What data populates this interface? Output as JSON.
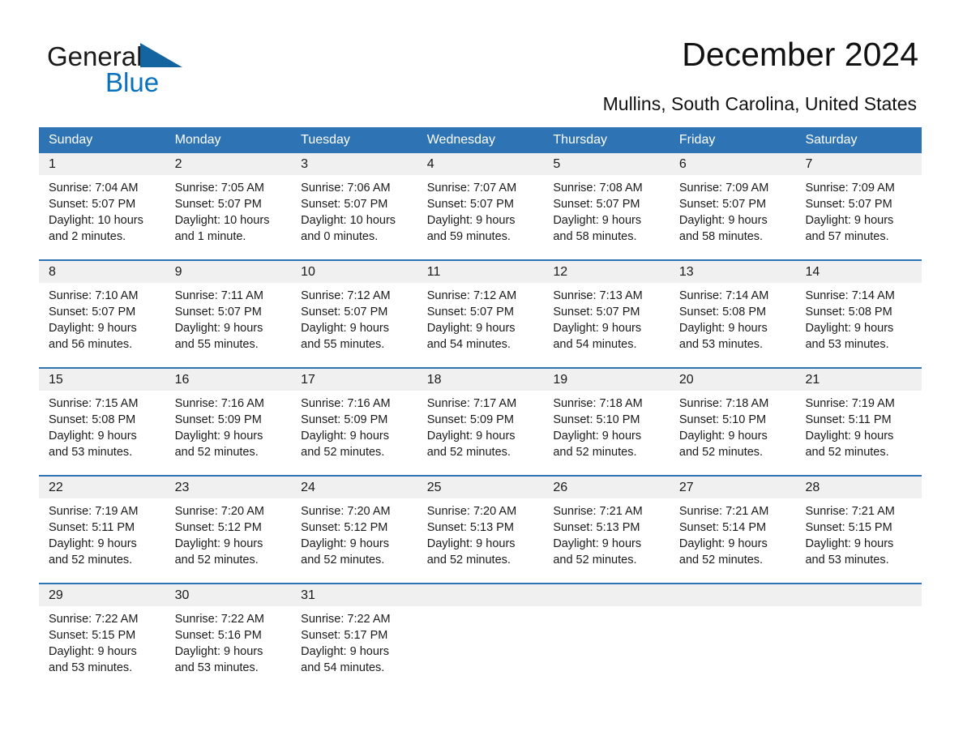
{
  "brand": {
    "word1": "General",
    "word2": "Blue",
    "accent_color": "#0a72bd",
    "triangle_icon": "triangle-logo-icon"
  },
  "header": {
    "title": "December 2024",
    "location": "Mullins, South Carolina, United States"
  },
  "calendar": {
    "header_color": "#2e74b5",
    "daynum_band_color": "#f0f0f0",
    "weekdays": [
      "Sunday",
      "Monday",
      "Tuesday",
      "Wednesday",
      "Thursday",
      "Friday",
      "Saturday"
    ],
    "weeks": [
      [
        {
          "day": "1",
          "sunrise": "Sunrise: 7:04 AM",
          "sunset": "Sunset: 5:07 PM",
          "daylight1": "Daylight: 10 hours",
          "daylight2": "and 2 minutes."
        },
        {
          "day": "2",
          "sunrise": "Sunrise: 7:05 AM",
          "sunset": "Sunset: 5:07 PM",
          "daylight1": "Daylight: 10 hours",
          "daylight2": "and 1 minute."
        },
        {
          "day": "3",
          "sunrise": "Sunrise: 7:06 AM",
          "sunset": "Sunset: 5:07 PM",
          "daylight1": "Daylight: 10 hours",
          "daylight2": "and 0 minutes."
        },
        {
          "day": "4",
          "sunrise": "Sunrise: 7:07 AM",
          "sunset": "Sunset: 5:07 PM",
          "daylight1": "Daylight: 9 hours",
          "daylight2": "and 59 minutes."
        },
        {
          "day": "5",
          "sunrise": "Sunrise: 7:08 AM",
          "sunset": "Sunset: 5:07 PM",
          "daylight1": "Daylight: 9 hours",
          "daylight2": "and 58 minutes."
        },
        {
          "day": "6",
          "sunrise": "Sunrise: 7:09 AM",
          "sunset": "Sunset: 5:07 PM",
          "daylight1": "Daylight: 9 hours",
          "daylight2": "and 58 minutes."
        },
        {
          "day": "7",
          "sunrise": "Sunrise: 7:09 AM",
          "sunset": "Sunset: 5:07 PM",
          "daylight1": "Daylight: 9 hours",
          "daylight2": "and 57 minutes."
        }
      ],
      [
        {
          "day": "8",
          "sunrise": "Sunrise: 7:10 AM",
          "sunset": "Sunset: 5:07 PM",
          "daylight1": "Daylight: 9 hours",
          "daylight2": "and 56 minutes."
        },
        {
          "day": "9",
          "sunrise": "Sunrise: 7:11 AM",
          "sunset": "Sunset: 5:07 PM",
          "daylight1": "Daylight: 9 hours",
          "daylight2": "and 55 minutes."
        },
        {
          "day": "10",
          "sunrise": "Sunrise: 7:12 AM",
          "sunset": "Sunset: 5:07 PM",
          "daylight1": "Daylight: 9 hours",
          "daylight2": "and 55 minutes."
        },
        {
          "day": "11",
          "sunrise": "Sunrise: 7:12 AM",
          "sunset": "Sunset: 5:07 PM",
          "daylight1": "Daylight: 9 hours",
          "daylight2": "and 54 minutes."
        },
        {
          "day": "12",
          "sunrise": "Sunrise: 7:13 AM",
          "sunset": "Sunset: 5:07 PM",
          "daylight1": "Daylight: 9 hours",
          "daylight2": "and 54 minutes."
        },
        {
          "day": "13",
          "sunrise": "Sunrise: 7:14 AM",
          "sunset": "Sunset: 5:08 PM",
          "daylight1": "Daylight: 9 hours",
          "daylight2": "and 53 minutes."
        },
        {
          "day": "14",
          "sunrise": "Sunrise: 7:14 AM",
          "sunset": "Sunset: 5:08 PM",
          "daylight1": "Daylight: 9 hours",
          "daylight2": "and 53 minutes."
        }
      ],
      [
        {
          "day": "15",
          "sunrise": "Sunrise: 7:15 AM",
          "sunset": "Sunset: 5:08 PM",
          "daylight1": "Daylight: 9 hours",
          "daylight2": "and 53 minutes."
        },
        {
          "day": "16",
          "sunrise": "Sunrise: 7:16 AM",
          "sunset": "Sunset: 5:09 PM",
          "daylight1": "Daylight: 9 hours",
          "daylight2": "and 52 minutes."
        },
        {
          "day": "17",
          "sunrise": "Sunrise: 7:16 AM",
          "sunset": "Sunset: 5:09 PM",
          "daylight1": "Daylight: 9 hours",
          "daylight2": "and 52 minutes."
        },
        {
          "day": "18",
          "sunrise": "Sunrise: 7:17 AM",
          "sunset": "Sunset: 5:09 PM",
          "daylight1": "Daylight: 9 hours",
          "daylight2": "and 52 minutes."
        },
        {
          "day": "19",
          "sunrise": "Sunrise: 7:18 AM",
          "sunset": "Sunset: 5:10 PM",
          "daylight1": "Daylight: 9 hours",
          "daylight2": "and 52 minutes."
        },
        {
          "day": "20",
          "sunrise": "Sunrise: 7:18 AM",
          "sunset": "Sunset: 5:10 PM",
          "daylight1": "Daylight: 9 hours",
          "daylight2": "and 52 minutes."
        },
        {
          "day": "21",
          "sunrise": "Sunrise: 7:19 AM",
          "sunset": "Sunset: 5:11 PM",
          "daylight1": "Daylight: 9 hours",
          "daylight2": "and 52 minutes."
        }
      ],
      [
        {
          "day": "22",
          "sunrise": "Sunrise: 7:19 AM",
          "sunset": "Sunset: 5:11 PM",
          "daylight1": "Daylight: 9 hours",
          "daylight2": "and 52 minutes."
        },
        {
          "day": "23",
          "sunrise": "Sunrise: 7:20 AM",
          "sunset": "Sunset: 5:12 PM",
          "daylight1": "Daylight: 9 hours",
          "daylight2": "and 52 minutes."
        },
        {
          "day": "24",
          "sunrise": "Sunrise: 7:20 AM",
          "sunset": "Sunset: 5:12 PM",
          "daylight1": "Daylight: 9 hours",
          "daylight2": "and 52 minutes."
        },
        {
          "day": "25",
          "sunrise": "Sunrise: 7:20 AM",
          "sunset": "Sunset: 5:13 PM",
          "daylight1": "Daylight: 9 hours",
          "daylight2": "and 52 minutes."
        },
        {
          "day": "26",
          "sunrise": "Sunrise: 7:21 AM",
          "sunset": "Sunset: 5:13 PM",
          "daylight1": "Daylight: 9 hours",
          "daylight2": "and 52 minutes."
        },
        {
          "day": "27",
          "sunrise": "Sunrise: 7:21 AM",
          "sunset": "Sunset: 5:14 PM",
          "daylight1": "Daylight: 9 hours",
          "daylight2": "and 52 minutes."
        },
        {
          "day": "28",
          "sunrise": "Sunrise: 7:21 AM",
          "sunset": "Sunset: 5:15 PM",
          "daylight1": "Daylight: 9 hours",
          "daylight2": "and 53 minutes."
        }
      ],
      [
        {
          "day": "29",
          "sunrise": "Sunrise: 7:22 AM",
          "sunset": "Sunset: 5:15 PM",
          "daylight1": "Daylight: 9 hours",
          "daylight2": "and 53 minutes."
        },
        {
          "day": "30",
          "sunrise": "Sunrise: 7:22 AM",
          "sunset": "Sunset: 5:16 PM",
          "daylight1": "Daylight: 9 hours",
          "daylight2": "and 53 minutes."
        },
        {
          "day": "31",
          "sunrise": "Sunrise: 7:22 AM",
          "sunset": "Sunset: 5:17 PM",
          "daylight1": "Daylight: 9 hours",
          "daylight2": "and 54 minutes."
        },
        {
          "day": "",
          "sunrise": "",
          "sunset": "",
          "daylight1": "",
          "daylight2": ""
        },
        {
          "day": "",
          "sunrise": "",
          "sunset": "",
          "daylight1": "",
          "daylight2": ""
        },
        {
          "day": "",
          "sunrise": "",
          "sunset": "",
          "daylight1": "",
          "daylight2": ""
        },
        {
          "day": "",
          "sunrise": "",
          "sunset": "",
          "daylight1": "",
          "daylight2": ""
        }
      ]
    ]
  }
}
